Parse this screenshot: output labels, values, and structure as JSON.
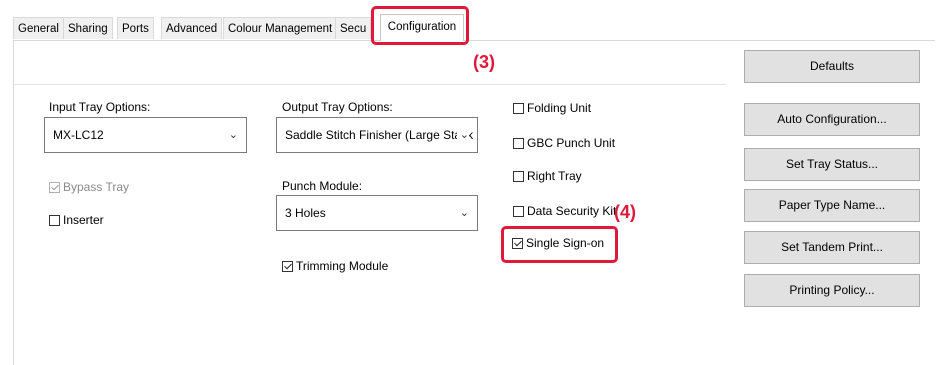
{
  "tabs": [
    "General",
    "Sharing",
    "Ports",
    "Advanced",
    "Colour Management",
    "Secu",
    "Configuration"
  ],
  "callouts": {
    "tab_step": "(3)",
    "checkbox_step": "(4)"
  },
  "input_tray": {
    "label": "Input Tray Options:",
    "value": "MX-LC12"
  },
  "output_tray": {
    "label": "Output Tray Options:",
    "value": "Saddle Stitch Finisher (Large Stack"
  },
  "punch_module": {
    "label": "Punch Module:",
    "value": "3 Holes"
  },
  "checkboxes": {
    "bypass_tray": {
      "label": "Bypass Tray",
      "checked": true,
      "disabled": true
    },
    "inserter": {
      "label": "Inserter",
      "checked": false
    },
    "trimming_module": {
      "label": "Trimming Module",
      "checked": true
    },
    "folding_unit": {
      "label": "Folding Unit",
      "checked": false
    },
    "gbc_punch_unit": {
      "label": "GBC Punch Unit",
      "checked": false
    },
    "right_tray": {
      "label": "Right Tray",
      "checked": false
    },
    "data_security_kit": {
      "label": "Data Security Kit",
      "checked": false
    },
    "single_sign_on": {
      "label": "Single Sign-on",
      "checked": true
    }
  },
  "buttons": {
    "defaults": "Defaults",
    "auto_configuration": "Auto Configuration...",
    "set_tray_status": "Set Tray Status...",
    "paper_type_name": "Paper Type Name...",
    "set_tandem_print": "Set Tandem Print...",
    "printing_policy": "Printing Policy..."
  },
  "colors": {
    "highlight": "#e0183a",
    "button_bg": "#e1e1e1"
  }
}
